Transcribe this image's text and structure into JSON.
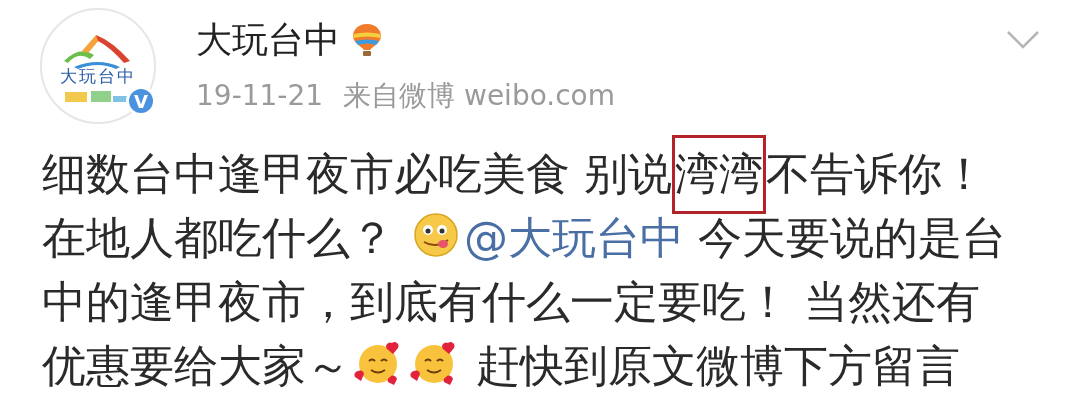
{
  "post": {
    "avatar": {
      "text": "大玩台中",
      "badge": "V"
    },
    "author": "大玩台中",
    "date": "19-11-21",
    "source": "来自微博 weibo.com",
    "lines": [
      [
        {
          "kind": "text",
          "text": "细数台中逢甲夜市必吃美食 别说"
        },
        {
          "kind": "boxed",
          "text": "湾湾"
        },
        {
          "kind": "text",
          "text": "不告诉你！"
        }
      ],
      [
        {
          "kind": "text",
          "text": "在地人都吃什么？ "
        },
        {
          "kind": "emoji_tongue"
        },
        {
          "kind": "mention",
          "text": "@大玩台中"
        },
        {
          "kind": "text",
          "text": " 今天要说的是台"
        }
      ],
      [
        {
          "kind": "text",
          "text": "中的逢甲夜市，到底有什么一定要吃！ 当然还有"
        }
      ],
      [
        {
          "kind": "text",
          "text": "优惠要给大家～"
        },
        {
          "kind": "emoji_hearts"
        },
        {
          "kind": "emoji_hearts"
        },
        {
          "kind": "text",
          "text": " 赶快到原文微博下方留言"
        }
      ]
    ]
  }
}
